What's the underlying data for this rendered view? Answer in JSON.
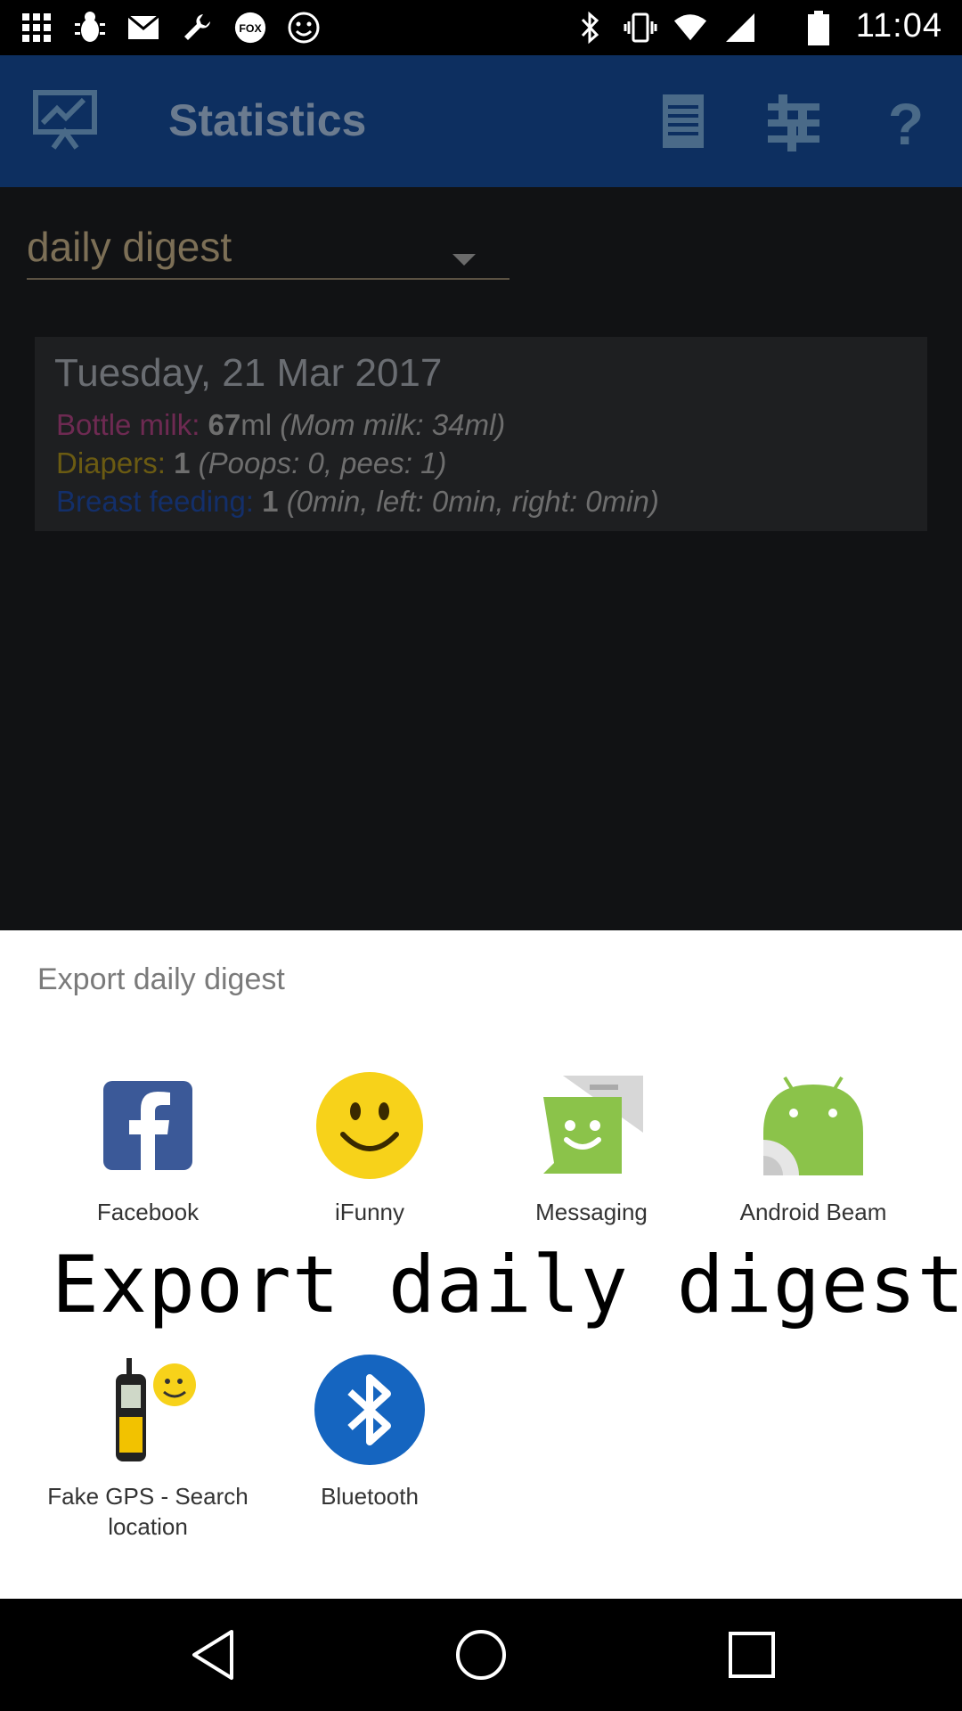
{
  "status_bar": {
    "time": "11:04",
    "icons": [
      "grid-icon",
      "bug-icon",
      "mail-icon",
      "wrench-icon",
      "fox-sports-icon",
      "smiley-icon"
    ],
    "right_icons": [
      "bluetooth-icon",
      "vibrate-icon",
      "wifi-icon",
      "signal-icon",
      "battery-icon"
    ],
    "fox_label": "FOX"
  },
  "app_bar": {
    "title": "Statistics",
    "actions": [
      "list-icon",
      "sliders-icon",
      "help-icon"
    ],
    "help_glyph": "?",
    "bg_color": "#0d2f60"
  },
  "content": {
    "spinner_value": "daily digest",
    "card": {
      "date": "Tuesday, 21 Mar 2017",
      "bottle": {
        "label": "Bottle milk:",
        "value": "67",
        "unit": "ml",
        "detail": "(Mom milk: 34ml)",
        "color": "#6e2a52"
      },
      "diapers": {
        "label": "Diapers:",
        "value": "1",
        "detail": "(Poops: 0, pees: 1)",
        "color": "#6b5b12"
      },
      "breast": {
        "label": "Breast feeding:",
        "value": "1",
        "detail": "(0min, left: 0min, right: 0min)",
        "color": "#132f6a"
      }
    }
  },
  "share_sheet": {
    "title": "Export daily digest",
    "overlay_text": "Export daily digest",
    "apps": [
      {
        "label": "Facebook",
        "icon": "facebook-icon"
      },
      {
        "label": "iFunny",
        "icon": "ifunny-icon"
      },
      {
        "label": "Messaging",
        "icon": "messaging-icon"
      },
      {
        "label": "Android Beam",
        "icon": "android-beam-icon"
      },
      {
        "label": "Fake GPS - Search location",
        "icon": "fake-gps-icon"
      },
      {
        "label": "Bluetooth",
        "icon": "bluetooth-icon"
      }
    ]
  },
  "nav_bar": {
    "buttons": [
      "back-icon",
      "home-icon",
      "recents-icon"
    ]
  }
}
